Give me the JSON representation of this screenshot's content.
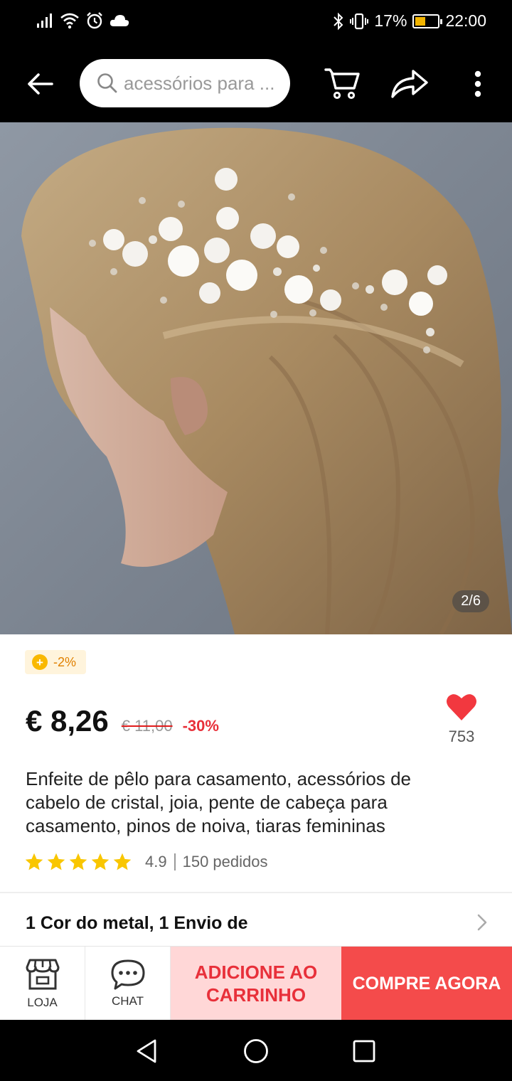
{
  "status_bar": {
    "battery_text": "17%",
    "time": "22:00"
  },
  "search": {
    "placeholder": "acessórios para ..."
  },
  "gallery": {
    "counter": "2/6"
  },
  "coin_badge": {
    "icon": "+",
    "text": "-2%"
  },
  "price": {
    "current": "€ 8,26",
    "original": "€ 11,00",
    "discount": "-30%"
  },
  "wishlist": {
    "count": "753"
  },
  "product": {
    "title": "Enfeite de pêlo para casamento, acessórios de cabelo de cristal, joia, pente de cabeça para casamento, pinos de noiva, tiaras femininas",
    "rating": "4.9",
    "orders": "150 pedidos"
  },
  "sku": {
    "text": "1 Cor do metal, 1 Envio de"
  },
  "bottom_bar": {
    "store_label": "LOJA",
    "chat_label": "CHAT",
    "add_to_cart_line1": "ADICIONE AO",
    "add_to_cart_line2": "CARRINHO",
    "buy_now": "COMPRE AGORA"
  },
  "colors": {
    "accent_red": "#f44b4b",
    "cart_bg": "#ffd7d7",
    "star_yellow": "#f9c600",
    "heart_red": "#f2383f"
  }
}
